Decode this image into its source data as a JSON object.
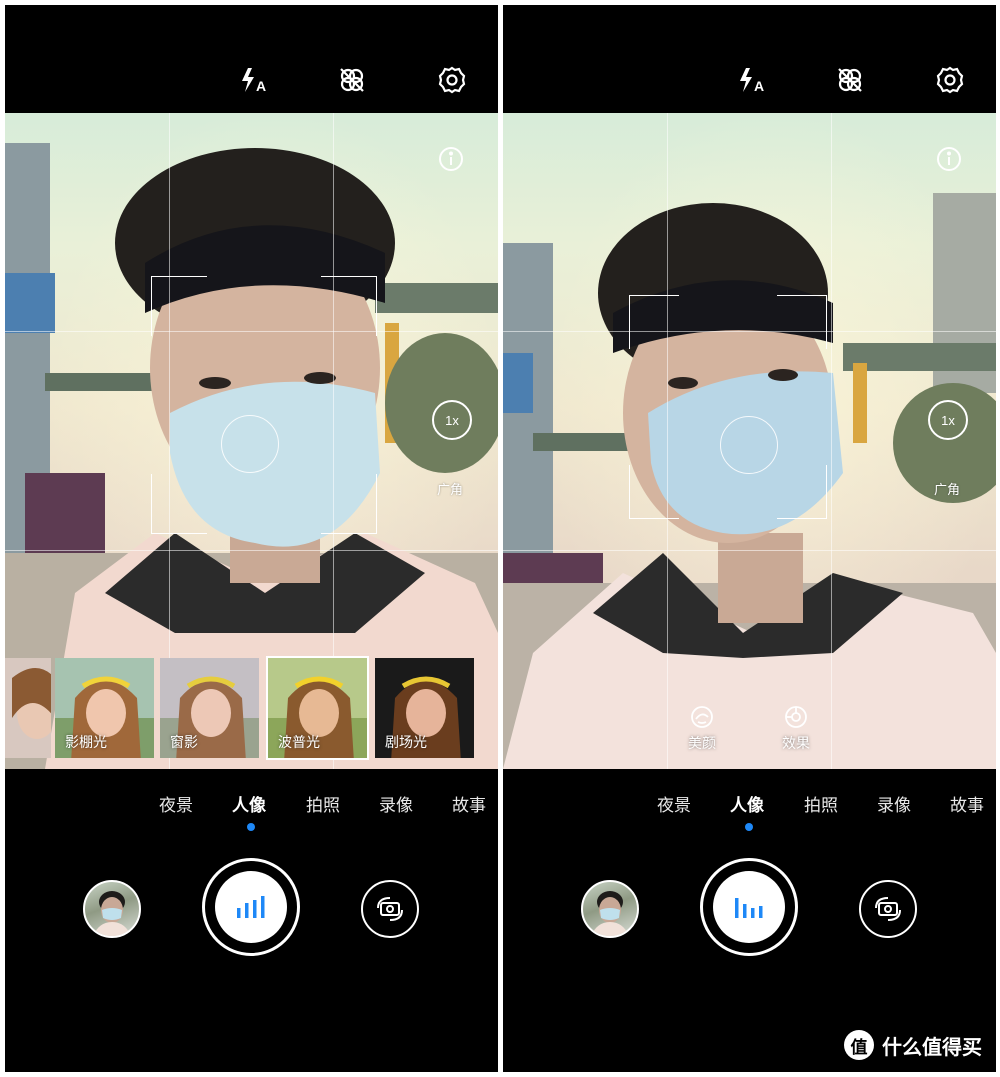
{
  "panels": [
    {
      "top_icons": [
        "flash-auto-icon",
        "ai-off-icon",
        "settings-gear-icon"
      ],
      "flash_label": "A",
      "zoom_label": "1x",
      "wide_label": "广角",
      "filters": [
        {
          "label": ""
        },
        {
          "label": "影棚光"
        },
        {
          "label": "窗影"
        },
        {
          "label": "波普光"
        },
        {
          "label": "剧场光"
        }
      ],
      "selected_filter": "波普光",
      "modes": [
        "夜景",
        "人像",
        "拍照",
        "录像",
        "故事"
      ],
      "active_mode": "人像"
    },
    {
      "top_icons": [
        "flash-auto-icon",
        "ai-off-icon",
        "settings-gear-icon"
      ],
      "flash_label": "A",
      "zoom_label": "1x",
      "wide_label": "广角",
      "quick_buttons": [
        {
          "icon": "beauty-face-icon",
          "label": "美颜"
        },
        {
          "icon": "effect-aperture-icon",
          "label": "效果"
        }
      ],
      "modes": [
        "夜景",
        "人像",
        "拍照",
        "录像",
        "故事"
      ],
      "active_mode": "人像"
    }
  ],
  "watermark": {
    "logo": "值",
    "text": "什么值得买"
  },
  "colors": {
    "accent": "#1e88f7",
    "background": "#000000",
    "foreground": "#ffffff"
  }
}
